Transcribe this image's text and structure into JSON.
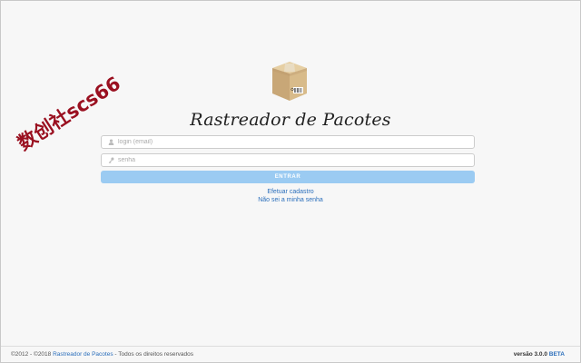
{
  "app": {
    "title": "Rastreador de Pacotes",
    "brand_color": "#9bcbf2",
    "link_color": "#2a6ebb"
  },
  "logo": {
    "icon": "package-box-icon"
  },
  "form": {
    "login_placeholder": "login (email)",
    "login_icon": "user-icon",
    "password_placeholder": "senha",
    "password_icon": "key-icon",
    "submit_label": "ENTRAR"
  },
  "links": {
    "register": "Efetuar cadastro",
    "forgot_password": "Não sei a minha senha"
  },
  "watermark": {
    "text": "数创社scs66"
  },
  "footer": {
    "copyright_prefix": "©2012 - ©2018",
    "app_link": "Rastreador de Pacotes",
    "copyright_suffix": "- Todos os direitos reservados",
    "version_label": "versão 3.0.0",
    "version_tag": "BETA"
  }
}
